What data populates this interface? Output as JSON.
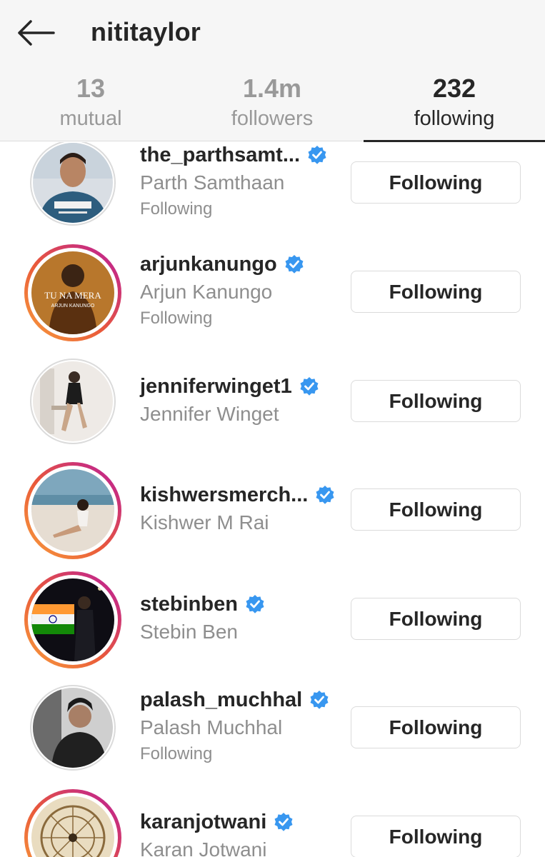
{
  "header": {
    "title": "nititaylor",
    "tabs": [
      {
        "count": "13",
        "label": "mutual"
      },
      {
        "count": "1.4m",
        "label": "followers"
      },
      {
        "count": "232",
        "label": "following"
      }
    ]
  },
  "users": [
    {
      "handle": "the_parthsamt...",
      "name": "Parth Samthaan",
      "sub": "Following",
      "button": "Following"
    },
    {
      "handle": "arjunkanungo",
      "name": "Arjun Kanungo",
      "sub": "Following",
      "button": "Following",
      "avatar_text_1": "TU NA MERA",
      "avatar_text_2": "ARJUN KANUNGO"
    },
    {
      "handle": "jenniferwinget1",
      "name": "Jennifer Winget",
      "button": "Following"
    },
    {
      "handle": "kishwersmerch...",
      "name": "Kishwer M Rai",
      "button": "Following"
    },
    {
      "handle": "stebinben",
      "name": "Stebin Ben",
      "button": "Following"
    },
    {
      "handle": "palash_muchhal",
      "name": "Palash Muchhal",
      "sub": "Following",
      "button": "Following"
    },
    {
      "handle": "karanjotwani",
      "name": "Karan Jotwani",
      "button": "Following"
    }
  ],
  "colors": {
    "verified": "#3897f0",
    "active_tab": "#262626",
    "inactive_tab": "#999999"
  }
}
